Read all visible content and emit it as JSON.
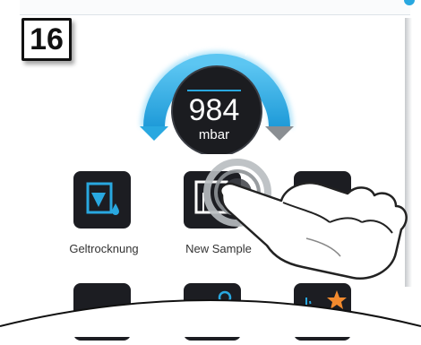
{
  "step": {
    "number": "16"
  },
  "gauge": {
    "value": "984",
    "unit": "mbar"
  },
  "tiles": [
    {
      "label": "Geltrocknung",
      "icon": "gel-drying-icon"
    },
    {
      "label": "New Sample",
      "icon": "new-sample-icon"
    }
  ],
  "colors": {
    "accent": "#29a8e0",
    "tile_bg": "#1c1d22",
    "gauge_arc": "#4ab8ec"
  }
}
